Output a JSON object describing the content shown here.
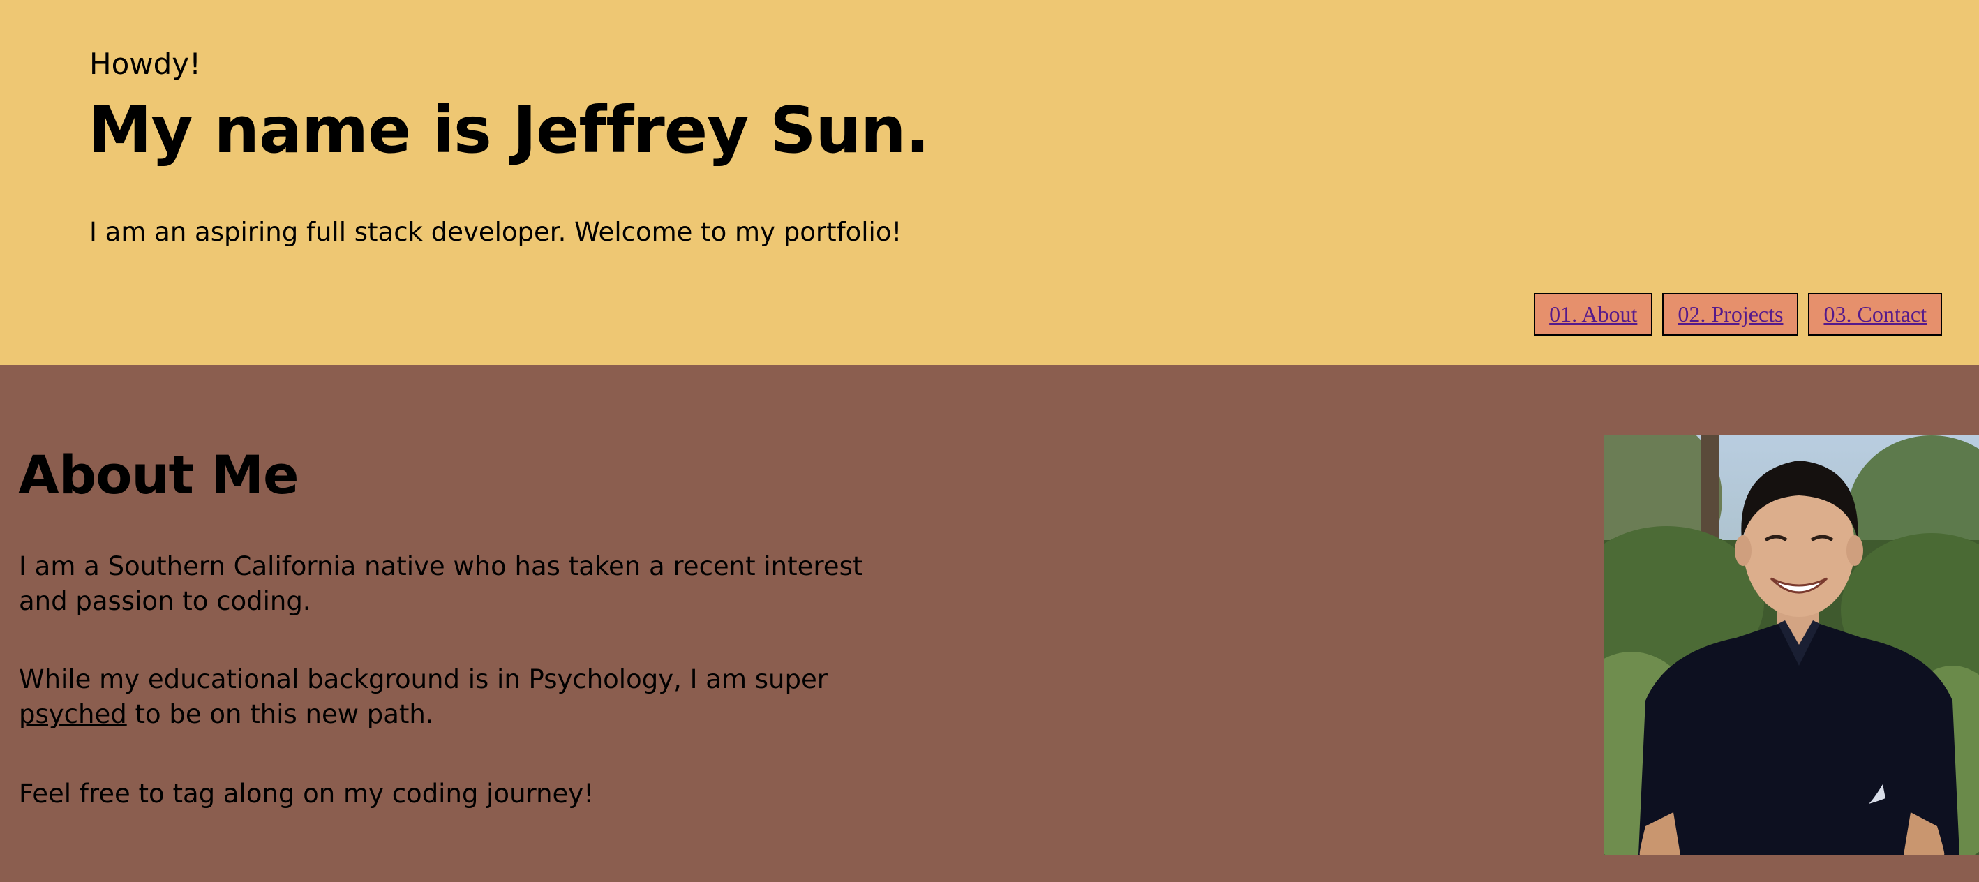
{
  "header": {
    "greeting": "Howdy!",
    "name_line": "My name is Jeffrey Sun.",
    "tagline": "I am an aspiring full stack developer. Welcome to my portfolio!",
    "nav": [
      {
        "label": "01. About"
      },
      {
        "label": "02. Projects"
      },
      {
        "label": "03. Contact"
      }
    ]
  },
  "about": {
    "title": "About Me",
    "p1": "I am a Southern California native who has taken a recent interest and passion to coding.",
    "p2_before": "While my educational background is in Psychology, I am super ",
    "p2_link": "psyched",
    "p2_after": " to be on this new path.",
    "p3": "Feel free to tag along on my coding journey!"
  },
  "colors": {
    "header_bg": "#eec773",
    "about_bg": "#8b5e4f",
    "nav_button_bg": "#e6906c",
    "nav_link": "#551a8b"
  }
}
